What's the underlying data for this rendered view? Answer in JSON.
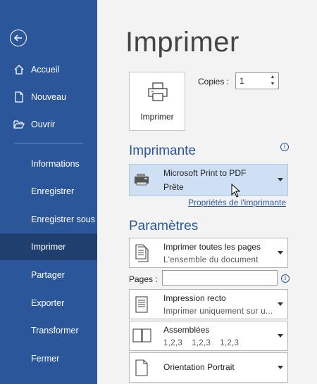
{
  "sidebar": {
    "back_label": "Retour",
    "items": [
      {
        "label": "Accueil",
        "icon": "home-icon"
      },
      {
        "label": "Nouveau",
        "icon": "new-document-icon"
      },
      {
        "label": "Ouvrir",
        "icon": "folder-open-icon"
      },
      {
        "label": "Informations"
      },
      {
        "label": "Enregistrer"
      },
      {
        "label": "Enregistrer sous"
      },
      {
        "label": "Imprimer",
        "active": true
      },
      {
        "label": "Partager"
      },
      {
        "label": "Exporter"
      },
      {
        "label": "Transformer"
      },
      {
        "label": "Fermer"
      }
    ]
  },
  "main": {
    "title": "Imprimer",
    "print_button_label": "Imprimer",
    "copies_label": "Copies :",
    "copies_value": "1"
  },
  "printer": {
    "heading": "Imprimante",
    "name": "Microsoft Print to PDF",
    "status": "Prête",
    "properties_link": "Propriétés de l'imprimante"
  },
  "settings": {
    "heading": "Paramètres",
    "print_range": {
      "title": "Imprimer toutes les pages",
      "subtitle": "L'ensemble du document"
    },
    "pages_label": "Pages :",
    "pages_value": "",
    "sides": {
      "title": "Impression recto",
      "subtitle": "Imprimer uniquement sur u..."
    },
    "collation": {
      "title": "Assemblées",
      "values": [
        "1,2,3",
        "1,2,3",
        "1,2,3"
      ]
    },
    "orientation": {
      "title": "Orientation Portrait"
    }
  },
  "colors": {
    "sidebar": "#2b579a",
    "sidebar_active": "#1f3f6e",
    "accent": "#2b579a",
    "selected_printer": "#cfe0f4"
  }
}
